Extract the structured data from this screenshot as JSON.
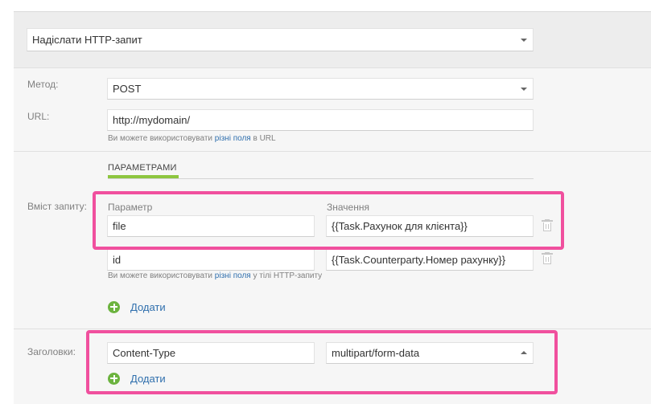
{
  "action": {
    "selected": "Надіслати HTTP-запит"
  },
  "method": {
    "label": "Метод:",
    "selected": "POST"
  },
  "url": {
    "label": "URL:",
    "value": "http://mydomain/",
    "hint_prefix": "Ви можете використовувати",
    "hint_link": "різні поля",
    "hint_suffix": "в URL"
  },
  "body": {
    "label": "Вміст запиту:",
    "tab": "ПАРАМЕТРАМИ",
    "col_param": "Параметр",
    "col_value": "Значення",
    "rows": [
      {
        "param": "file",
        "value": "{{Task.Рахунок для клієнта}}"
      },
      {
        "param": "id",
        "value": "{{Task.Counterparty.Номер рахунку}}"
      }
    ],
    "hint_prefix": "Ви можете використовувати",
    "hint_link": "різні поля",
    "hint_suffix": "у тілі HTTP-запиту",
    "add": "Додати"
  },
  "headers": {
    "label": "Заголовки:",
    "name": "Content-Type",
    "value": "multipart/form-data",
    "add": "Додати"
  },
  "colors": {
    "accent_green": "#8dc63f",
    "link_blue": "#2f6fad",
    "highlight_pink": "#f0509e"
  },
  "icons": {
    "delete": "trash-icon",
    "add": "plus-circle-icon"
  }
}
